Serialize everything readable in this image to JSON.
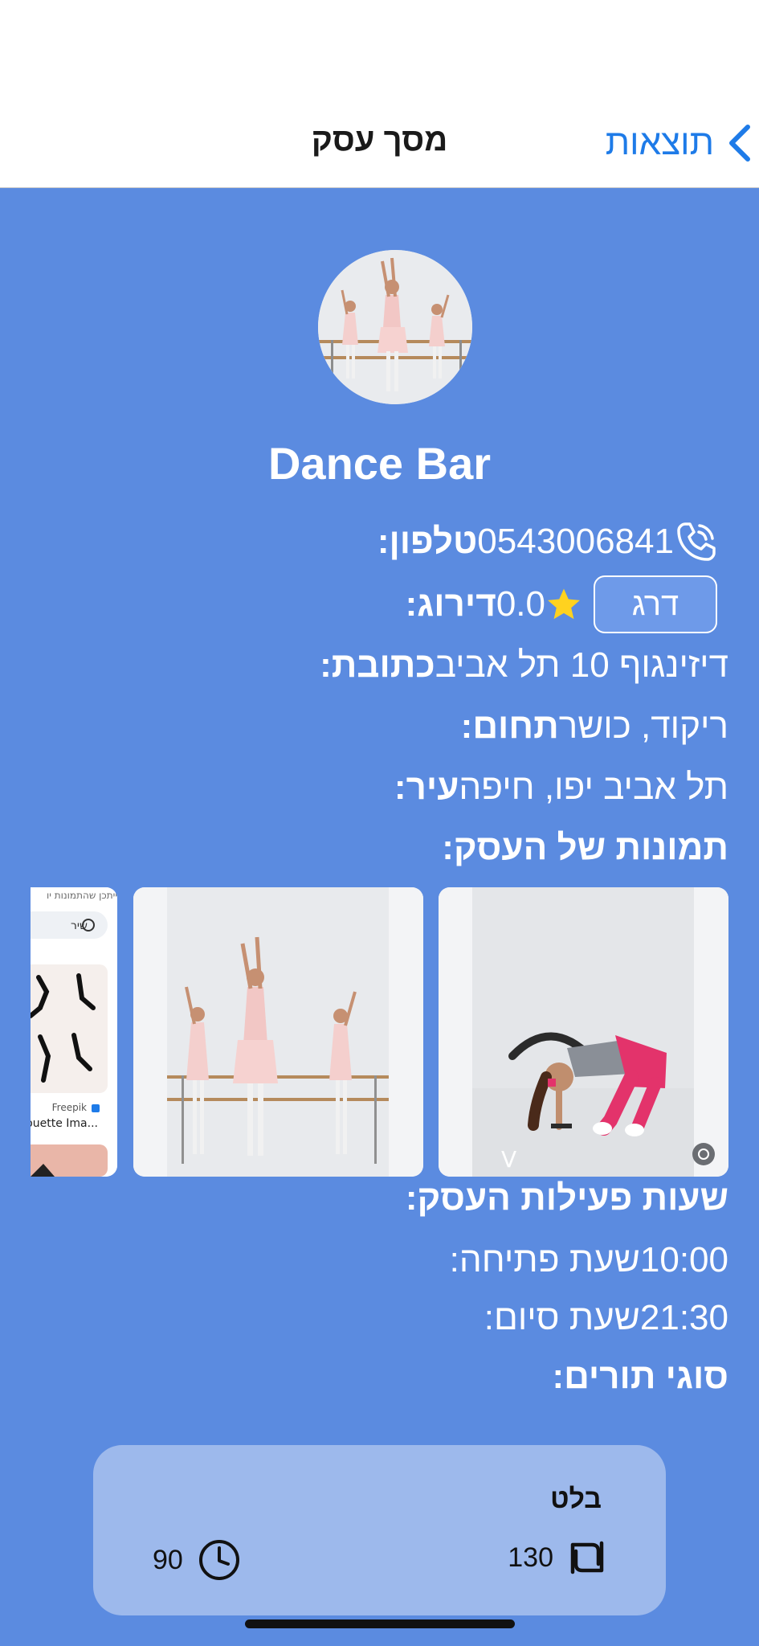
{
  "header": {
    "title": "מסך עסק",
    "back_label": "תוצאות"
  },
  "business": {
    "name": "Dance Bar",
    "phone_label": "טלפון:",
    "phone": "0543006841",
    "rating_label": "דירוג:",
    "rating": "0.0",
    "rate_button": "דרג",
    "address_label": "כתובת:",
    "address": "דיזינגוף 10 תל אביב",
    "field_label": "תחום:",
    "field": "ריקוד, כושר",
    "city_label": "עיר:",
    "city": "תל אביב יפו, חיפה"
  },
  "gallery": {
    "title": "תמונות של העסק:",
    "thumb3_caption_top": "ייתכן שהתמונות יו",
    "thumb3_share": "שיר",
    "thumb3_source": "Freepik",
    "thumb3_caption": "ilhouette Ima..."
  },
  "hours": {
    "title": "שעות פעילות העסק:",
    "open_label": "שעת פתיחה:",
    "open": "10:00",
    "close_label": "שעת סיום:",
    "close": "21:30"
  },
  "services": {
    "title": "סוגי תורים:",
    "items": [
      {
        "name": "בלט",
        "price": "130",
        "duration": "90"
      }
    ]
  },
  "colors": {
    "background": "#5B8BE0",
    "accent": "#1E7BE8",
    "star": "#FFD21F",
    "card": "#9DB9EC"
  }
}
